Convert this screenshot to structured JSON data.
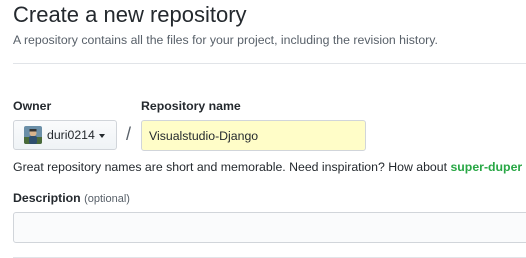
{
  "header": {
    "title": "Create a new repository",
    "subtitle": "A repository contains all the files for your project, including the revision history."
  },
  "owner": {
    "label": "Owner",
    "value": "duri0214",
    "avatar_icon": "user-avatar-icon",
    "dropdown_icon": "caret-down-icon"
  },
  "separator": "/",
  "repository": {
    "label": "Repository name",
    "value": "Visualstudio-Django"
  },
  "hint": {
    "text": "Great repository names are short and memorable. Need inspiration? How about ",
    "suggestion": "super-duper"
  },
  "description": {
    "label": "Description",
    "optional": "(optional)",
    "value": ""
  },
  "colors": {
    "input_highlight": "#fffdc8",
    "suggestion": "#28a745",
    "text": "#24292e",
    "muted": "#586069",
    "border": "#d1d5da"
  }
}
